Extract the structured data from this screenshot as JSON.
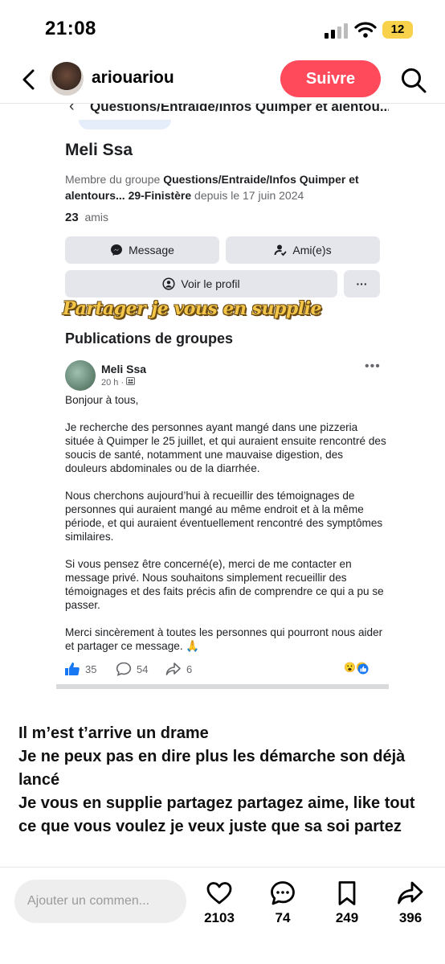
{
  "status": {
    "time": "21:08",
    "battery": "12"
  },
  "header": {
    "username": "ariouariou",
    "follow_label": "Suivre"
  },
  "fb": {
    "top_title": "Questions/Entraide/Infos Quimper et alentou...",
    "profile_name": "Meli Ssa",
    "member_prefix": "Membre du groupe ",
    "member_group": "Questions/Entraide/Infos Quimper et alentours... 29-Finistère",
    "member_suffix": " depuis le 17 juin 2024",
    "friends_count": "23",
    "friends_label": "amis",
    "message_label": "Message",
    "friends_button_label": "Ami(e)s",
    "view_profile_label": "Voir le profil",
    "more_label": "···",
    "overlay_text": "Partager je vous en supplie",
    "publications_title": "Publications de groupes",
    "post": {
      "author": "Meli Ssa",
      "time": "20 h ·",
      "paragraphs": [
        "Bonjour à tous,",
        "Je recherche des personnes ayant mangé dans une pizzeria située à Quimper le 25 juillet, et qui auraient ensuite rencontré des soucis de santé, notamment une mauvaise digestion, des douleurs abdominales ou de la diarrhée.",
        "Nous cherchons aujourd’hui à recueillir des témoignages de personnes qui auraient mangé au même endroit et à la même période, et qui auraient éventuellement rencontré des symptômes similaires.",
        "Si vous pensez être concerné(e), merci de me contacter en message privé. Nous souhaitons simplement recueillir des témoignages et des faits précis afin de comprendre ce qui a pu se passer.",
        "Merci sincèrement à toutes les personnes qui pourront nous aider et partager ce message. 🙏"
      ],
      "likes": "35",
      "comments": "54",
      "shares": "6",
      "reactions": "😮😢"
    }
  },
  "caption": {
    "lines": [
      "Il m’est t’arrive un drame",
      "Je ne peux pas en dire plus les démarche son déjà lancé",
      "Je vous en supplie partagez partagez aime, like tout ce que vous voulez je veux juste que sa soi partez"
    ]
  },
  "bottom_bar": {
    "comment_placeholder": "Ajouter un commen...",
    "likes": "2103",
    "comments": "74",
    "saves": "249",
    "shares": "396"
  },
  "colors": {
    "follow": "#ff4a5c",
    "battery": "#f7d24a",
    "fb_blue": "#1877f2"
  }
}
